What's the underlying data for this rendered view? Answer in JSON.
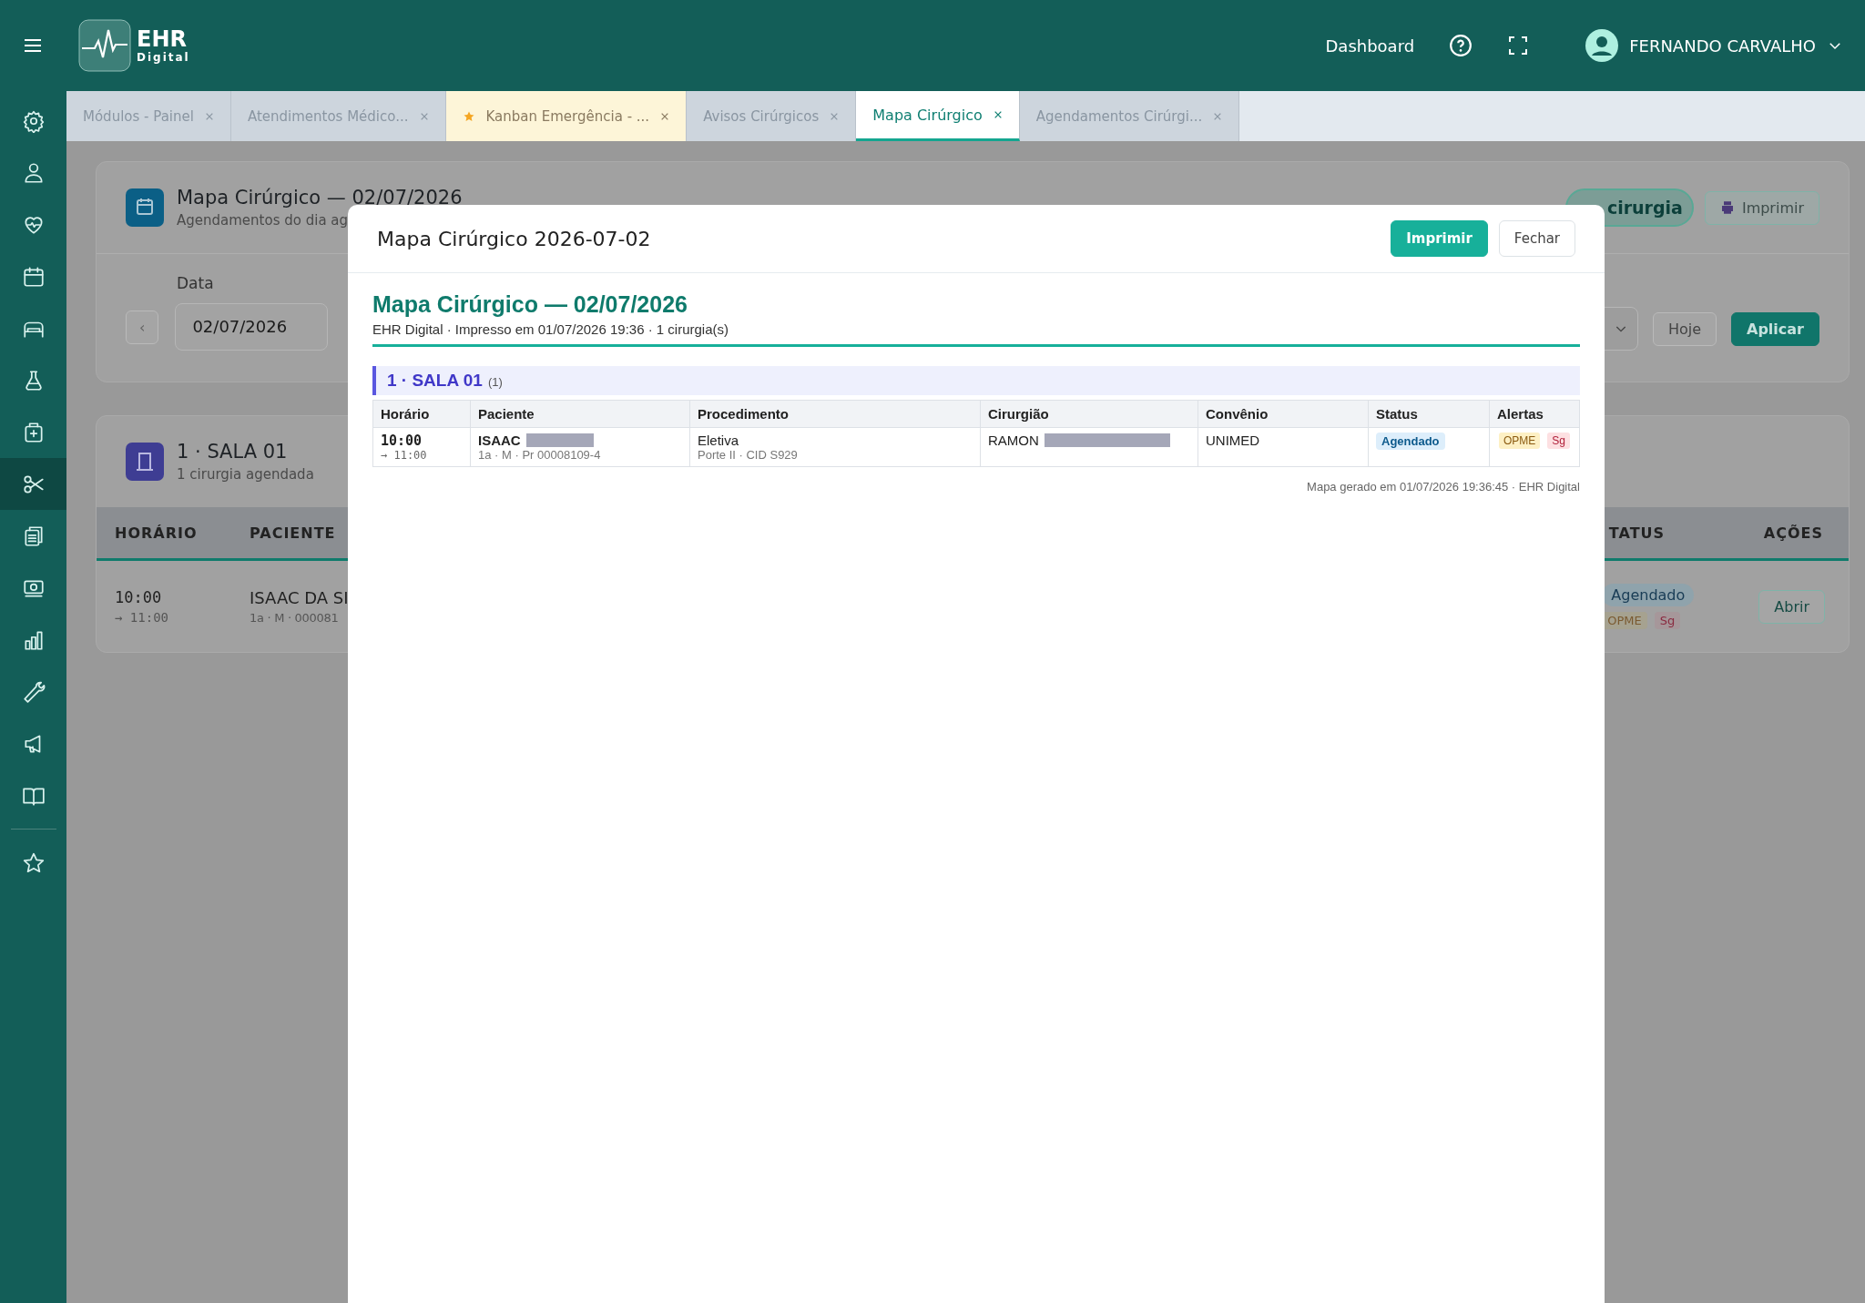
{
  "header": {
    "logo_title": "EHR",
    "logo_subtitle": "Digital",
    "nav_link": "Dashboard",
    "user": "FERNANDO CARVALHO"
  },
  "sidebar": {
    "items": [
      {
        "kind": "gear",
        "selected": false
      },
      {
        "kind": "person",
        "selected": false
      },
      {
        "kind": "heart",
        "selected": false
      },
      {
        "kind": "calendar",
        "selected": false
      },
      {
        "kind": "bed",
        "selected": false
      },
      {
        "kind": "flask",
        "selected": false
      },
      {
        "kind": "kit",
        "selected": false
      },
      {
        "kind": "scissors",
        "selected": true
      },
      {
        "kind": "clipboard",
        "selected": false
      },
      {
        "kind": "money",
        "selected": false
      },
      {
        "kind": "chart",
        "selected": false
      },
      {
        "kind": "wrench",
        "selected": false
      },
      {
        "kind": "megaphone",
        "selected": false
      },
      {
        "kind": "book",
        "selected": false
      }
    ],
    "favorite": {
      "kind": "star",
      "selected": false
    }
  },
  "tabs": [
    {
      "label": "Módulos - Painel",
      "selected": false,
      "starred": false
    },
    {
      "label": "Atendimentos Médico...",
      "selected": false,
      "starred": false
    },
    {
      "label": "Kanban Emergência - ...",
      "selected": false,
      "starred": true
    },
    {
      "label": "Avisos Cirúrgicos",
      "selected": false,
      "starred": false
    },
    {
      "label": "Mapa Cirúrgico",
      "selected": true,
      "starred": false
    },
    {
      "label": "Agendamentos Cirúrgi...",
      "selected": false,
      "starred": false
    }
  ],
  "page": {
    "title": "Mapa Cirúrgico — 02/07/2026",
    "subtitle": "Agendamentos do dia ag",
    "count_pill": "cirurgia",
    "print_button": "Imprimir",
    "filter": {
      "date_label": "Data",
      "prev_button": "‹",
      "date_value": "02/07/2026",
      "today_button": "Hoje",
      "apply_button": "Aplicar"
    },
    "room": {
      "title": "1 · SALA 01",
      "subtitle": "1 cirurgia agendada",
      "columns_left": [
        "HORÁRIO",
        "PACIENTE"
      ],
      "columns_right": [
        "TATUS",
        "AÇÕES"
      ],
      "row": {
        "start": "10:00",
        "end": "→ 11:00",
        "patient": "ISAAC DA SI",
        "patient_info": "1a · M · 000081",
        "status": "Agendado",
        "alerts": [
          "OPME",
          "Sg"
        ],
        "action": "Abrir"
      }
    }
  },
  "modal": {
    "title": "Mapa Cirúrgico 2026-07-02",
    "print_button": "Imprimir",
    "close_button": "Fechar",
    "heading": "Mapa Cirúrgico — 02/07/2026",
    "meta": "EHR Digital · Impresso em 01/07/2026 19:36 · 1 cirurgia(s)",
    "room_title": "1 · SALA 01",
    "room_count": "(1)",
    "columns": [
      "Horário",
      "Paciente",
      "Procedimento",
      "Cirurgião",
      "Convênio",
      "Status",
      "Alertas"
    ],
    "rows": [
      {
        "start": "10:00",
        "end": "→ 11:00",
        "patient": "ISAAC",
        "patient_redacted": true,
        "patient_info": "1a · M · Pr 00008109-4",
        "procedure": "Eletiva",
        "procedure_info": "Porte II · CID S929",
        "surgeon": "RAMON",
        "surgeon_redacted": true,
        "insurance": "UNIMED",
        "status": "Agendado",
        "alerts": [
          {
            "label": "OPME",
            "color": "#fdf0c4"
          },
          {
            "label": "Sg",
            "color": "#fde0e2"
          }
        ]
      }
    ],
    "footer": "Mapa gerado em 01/07/2026 19:36:45 · EHR Digital"
  }
}
